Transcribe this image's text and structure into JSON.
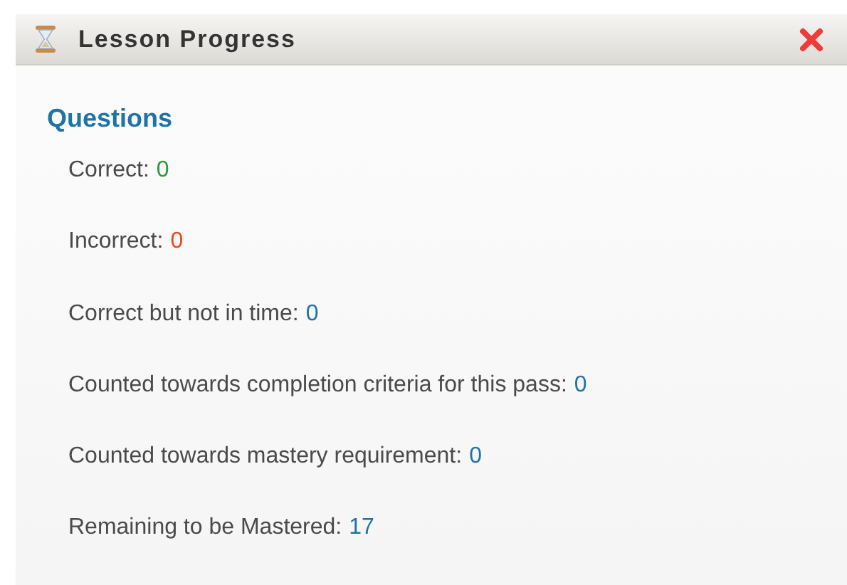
{
  "window": {
    "title": "Lesson Progress"
  },
  "section": {
    "heading": "Questions"
  },
  "stats": [
    {
      "label": "Correct:",
      "value": "0",
      "color": "#2a9a3a"
    },
    {
      "label": "Incorrect:",
      "value": "0",
      "color": "#f0461e"
    },
    {
      "label": "Correct but not in time:",
      "value": "0",
      "color": "#1f74a6"
    },
    {
      "label": "Counted towards completion criteria for this pass:",
      "value": "0",
      "color": "#1f74a6"
    },
    {
      "label": "Counted towards mastery requirement:",
      "value": "0",
      "color": "#1f74a6"
    },
    {
      "label": "Remaining to be Mastered:",
      "value": "17",
      "color": "#1f74a6"
    }
  ]
}
